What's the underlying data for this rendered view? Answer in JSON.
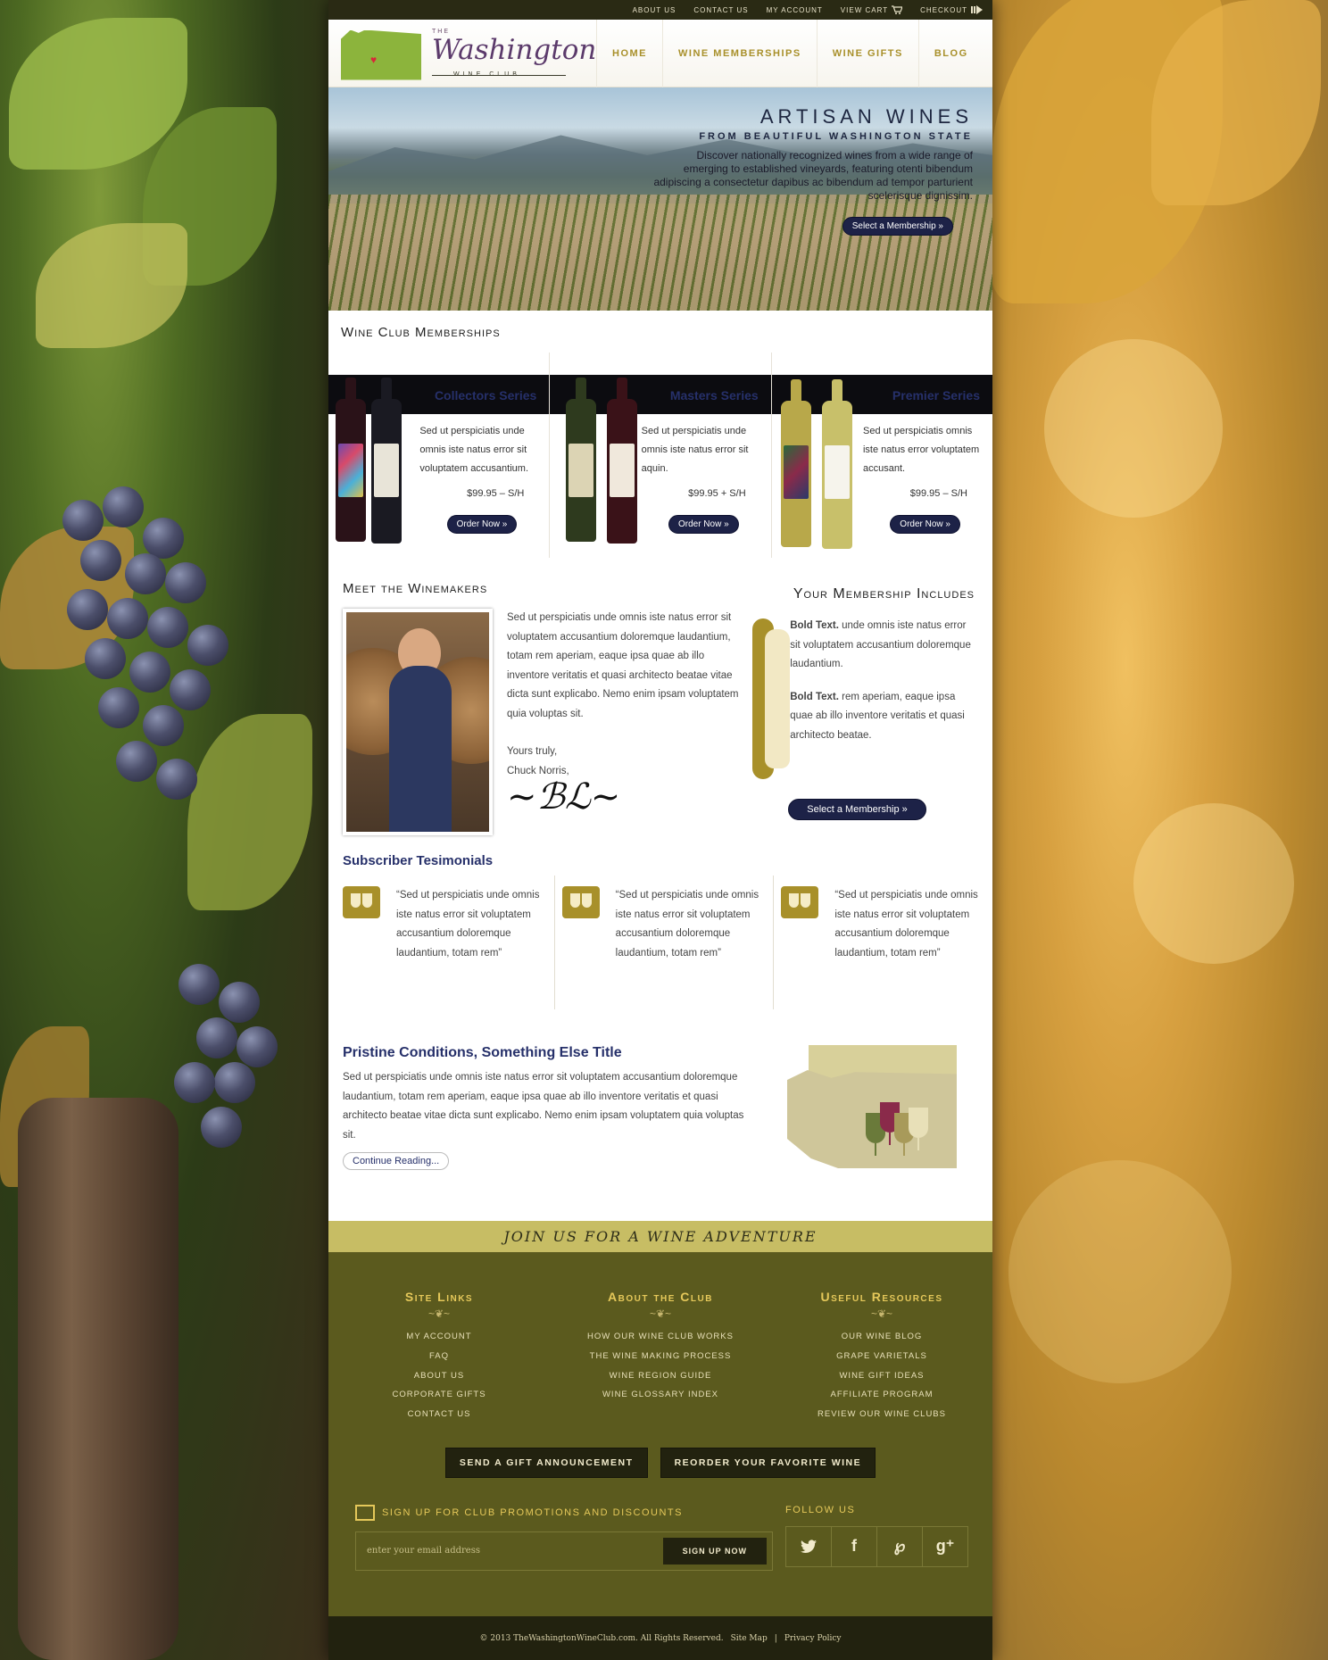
{
  "topbar": {
    "links": [
      "About Us",
      "Contact Us",
      "My Account",
      "View Cart",
      "Checkout"
    ]
  },
  "logo": {
    "the": "THE",
    "name": "Washington",
    "sub": "WINE CLUB"
  },
  "nav": [
    "Home",
    "Wine Memberships",
    "Wine Gifts",
    "Blog"
  ],
  "hero": {
    "title": "ARTISAN WINES",
    "subtitle": "FROM BEAUTIFUL WASHINGTON STATE",
    "body": "Discover nationally recognized wines from a wide range of emerging to established vineyards, featuring otenti bibendum adipiscing a consectetur dapibus ac bibendum ad tempor parturient scelerisque dignissim.",
    "button": "Select a Membership »"
  },
  "memberships": {
    "title": "Wine Club Memberships",
    "cards": [
      {
        "name": "Collectors Series",
        "desc": "Sed ut perspiciatis unde omnis iste natus error sit voluptatem accusantium.",
        "price": "$99.95 – S/H",
        "button": "Order Now »"
      },
      {
        "name": "Masters Series",
        "desc": "Sed ut perspiciatis unde omnis iste natus error sit aquin.",
        "price": "$99.95 + S/H",
        "button": "Order Now »"
      },
      {
        "name": "Premier Series",
        "desc": "Sed ut perspiciatis omnis iste natus error voluptatem accusant.",
        "price": "$99.95 – S/H",
        "button": "Order Now »"
      }
    ]
  },
  "winemakers": {
    "title": "Meet the Winemakers",
    "body": "Sed ut perspiciatis unde omnis iste natus error sit voluptatem accusantium doloremque laudantium, totam rem aperiam, eaque ipsa quae ab illo inventore veritatis et quasi architecto beatae vitae dicta sunt explicabo. Nemo enim ipsam voluptatem quia voluptas sit.",
    "closing": "Yours truly,",
    "author": "Chuck Norris,"
  },
  "includes": {
    "title": "Your Membership Includes",
    "items": [
      {
        "bold": "Bold Text.",
        "text": " unde omnis iste natus error sit voluptatem accusantium doloremque laudantium."
      },
      {
        "bold": "Bold Text.",
        "text": " rem aperiam, eaque ipsa quae ab illo inventore veritatis et quasi architecto beatae."
      }
    ],
    "button": "Select a Membership »"
  },
  "testimonials": {
    "title": "Subscriber Tesimonials",
    "quotes": [
      "“Sed ut perspiciatis unde omnis iste natus error sit voluptatem accusantium doloremque laudantium, totam rem”",
      "“Sed ut perspiciatis unde omnis iste natus error sit voluptatem accusantium doloremque laudantium, totam rem”",
      "“Sed ut perspiciatis unde omnis iste natus error sit voluptatem accusantium doloremque laudantium, totam rem”"
    ]
  },
  "pristine": {
    "title": "Pristine Conditions, Something Else Title",
    "body": "Sed ut perspiciatis unde omnis iste natus error sit voluptatem accusantium doloremque laudantium, totam rem aperiam, eaque ipsa quae ab illo inventore veritatis et quasi architecto beatae vitae dicta sunt explicabo. Nemo enim ipsam voluptatem quia voluptas sit.",
    "button": "Continue Reading..."
  },
  "join": "JOIN US FOR A WINE ADVENTURE",
  "footer": {
    "cols": [
      {
        "title": "Site Links",
        "links": [
          "My Account",
          "FAQ",
          "About Us",
          "Corporate Gifts",
          "Contact Us"
        ]
      },
      {
        "title": "About the Club",
        "links": [
          "How Our Wine Club Works",
          "The Wine Making Process",
          "Wine Region Guide",
          "Wine Glossary Index"
        ]
      },
      {
        "title": "Useful Resources",
        "links": [
          "Our Wine Blog",
          "Grape Varietals",
          "Wine Gift Ideas",
          "Affiliate Program",
          "Review Our Wine Clubs"
        ]
      }
    ],
    "buttons": [
      "Send a Gift Announcement",
      "Reorder Your Favorite Wine"
    ],
    "signup_label": "Sign up for club promotions and discounts",
    "email_placeholder": "enter your email address",
    "signup_button": "Sign Up Now",
    "follow_label": "Follow Us"
  },
  "copyright": {
    "text": "© 2013 TheWashingtonWineClub.com. All Rights Reserved.",
    "sitemap": "Site Map",
    "sep": "|",
    "privacy": "Privacy Policy"
  },
  "colors": {
    "gold": "#a8902a",
    "navy": "#1d2247",
    "olive": "#5b5a1e",
    "heading_blue": "#26306a"
  }
}
